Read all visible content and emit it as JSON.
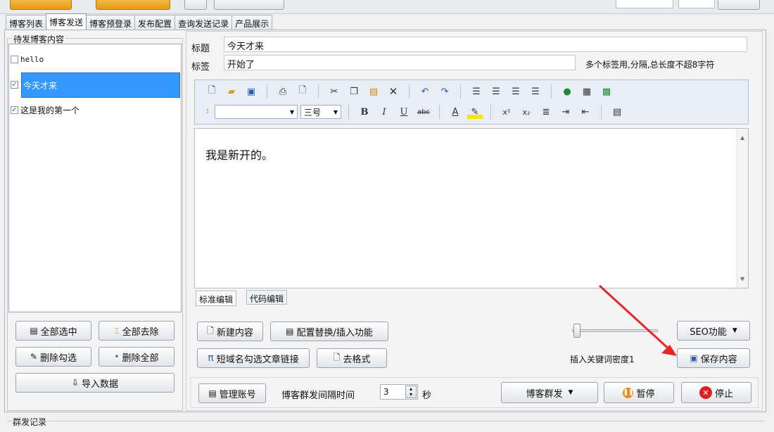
{
  "tabs": [
    "博客列表",
    "博客发送",
    "博客预登录",
    "发布配置",
    "查询发送记录",
    "产品展示"
  ],
  "active_tab": "博客发送",
  "left_panel": {
    "title": "待发博客内容",
    "items": [
      {
        "label": "hello",
        "checked": false,
        "selected": false
      },
      {
        "label": "今天才来",
        "checked": true,
        "selected": true
      },
      {
        "label": "这是我的第一个",
        "checked": true,
        "selected": false
      }
    ],
    "check_mark": "☑",
    "uncheck_mark": "☐",
    "buttons": {
      "select_all": "全部选中",
      "deselect_all": "全部去除",
      "delete_checked": "删除勾选",
      "delete_all": "删除全部",
      "import_data": "导入数据"
    }
  },
  "form": {
    "title_label": "标题",
    "title_value": "今天才来",
    "tag_label": "标签",
    "tag_value": "开始了",
    "tag_hint": "多个标签用,分隔,总长度不超8字符"
  },
  "toolbar": {
    "font_name": "",
    "font_size": "三号",
    "bold": "B",
    "italic": "I",
    "underline": "U",
    "strike": "abc",
    "font_color": "A",
    "superscript": "x²",
    "subscript": "x₂"
  },
  "editor": {
    "content": "我是新开的。",
    "tabs": [
      "标准编辑",
      "代码编辑"
    ]
  },
  "actions": {
    "new_content": "新建内容",
    "config_replace": "配置替换/插入功能",
    "short_domain": "短域名勾选文章链接",
    "clear_format": "去格式",
    "seo": "SEO功能",
    "keyword_density": "插入关键词密度1",
    "save_content": "保存内容",
    "manage_account": "管理账号",
    "interval_label": "博客群发间隔时间",
    "interval_value": "3",
    "interval_unit": "秒",
    "mass_send": "博客群发",
    "pause": "暂停",
    "stop": "停止"
  },
  "log": {
    "title": "群发记录"
  },
  "colors": {
    "selection": "#3399ff",
    "arrow": "#e8262a",
    "pause_icon": "#f08a1c",
    "stop_icon": "#e02020"
  }
}
